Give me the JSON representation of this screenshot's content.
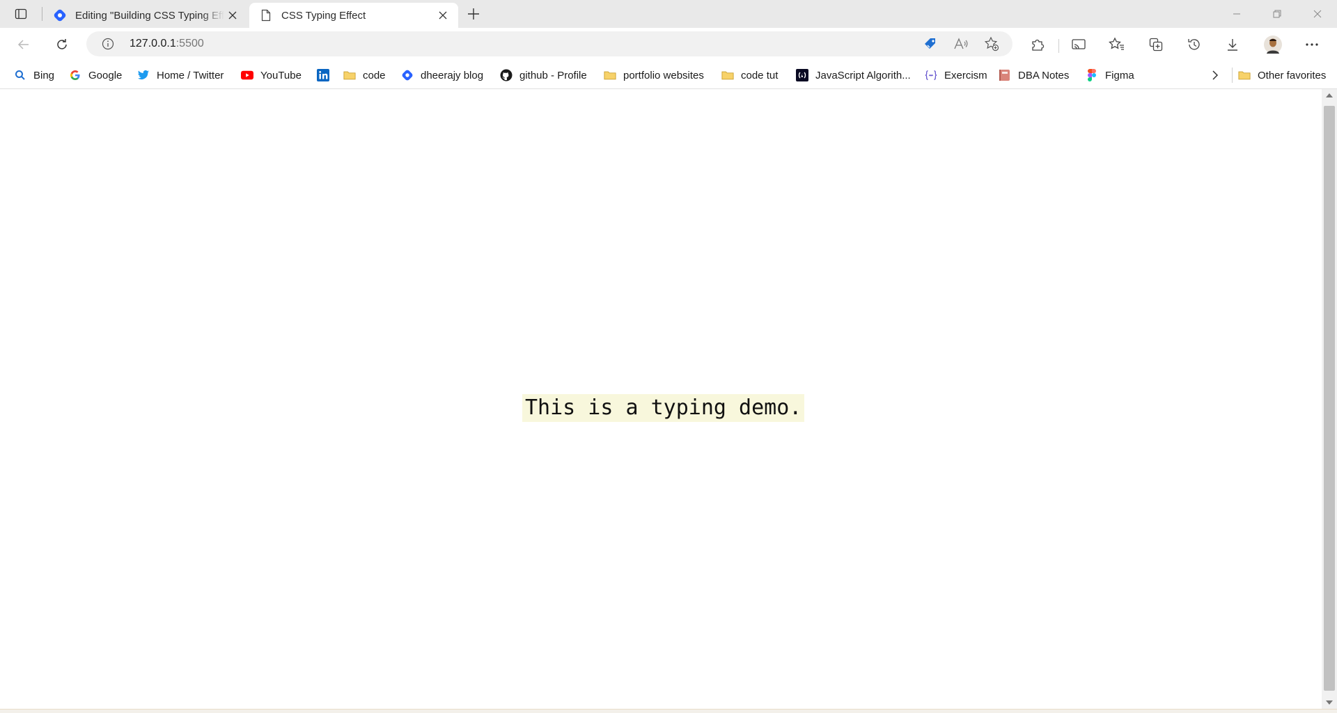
{
  "window": {
    "tabs": [
      {
        "title": "Editing \"Building CSS Typing Effect\"",
        "icon": "hashnode-icon",
        "active": false
      },
      {
        "title": "CSS Typing Effect",
        "icon": "page-icon",
        "active": true
      }
    ]
  },
  "address_bar": {
    "host": "127.0.0.1",
    "port": ":5500"
  },
  "favorites": [
    {
      "label": "Bing",
      "icon": "bing-search-icon"
    },
    {
      "label": "Google",
      "icon": "google-icon"
    },
    {
      "label": "Home / Twitter",
      "icon": "twitter-icon"
    },
    {
      "label": "YouTube",
      "icon": "youtube-icon"
    },
    {
      "label": "",
      "icon": "linkedin-icon"
    },
    {
      "label": "code",
      "icon": "folder-icon"
    },
    {
      "label": "dheerajy blog",
      "icon": "hashnode-icon"
    },
    {
      "label": "github - Profile",
      "icon": "github-icon"
    },
    {
      "label": "portfolio websites",
      "icon": "folder-icon"
    },
    {
      "label": "code tut",
      "icon": "folder-icon"
    },
    {
      "label": "JavaScript Algorith...",
      "icon": "freecodecamp-icon"
    },
    {
      "label": "Exercism",
      "icon": "exercism-icon"
    },
    {
      "label": "DBA Notes",
      "icon": "notebook-icon"
    },
    {
      "label": "Figma",
      "icon": "figma-icon"
    },
    {
      "label": "Other favorites",
      "icon": "folder-icon"
    }
  ],
  "page": {
    "demo_text": "This is a typing demo.",
    "highlight_color": "#f8f7dc"
  },
  "colors": {
    "tab_strip": "#e9e9e9",
    "favorites_star": "#1f6fd1",
    "youtube": "#ff0000",
    "twitter": "#1d9bf0",
    "folder": "#f7c948"
  }
}
